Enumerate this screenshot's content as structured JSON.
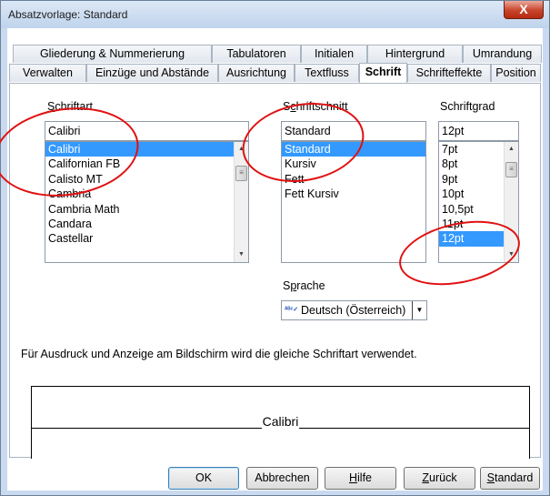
{
  "window": {
    "title": "Absatzvorlage: Standard",
    "close_glyph": "X"
  },
  "tabs_row1": [
    "Gliederung & Nummerierung",
    "Tabulatoren",
    "Initialen",
    "Hintergrund",
    "Umrandung"
  ],
  "tabs_row2": [
    "Verwalten",
    "Einzüge und Abstände",
    "Ausrichtung",
    "Textfluss",
    "Schrift",
    "Schrifteffekte",
    "Position"
  ],
  "active_tab": "Schrift",
  "font": {
    "label_accel": "S",
    "label_rest": "chriftart",
    "value": "Calibri",
    "items": [
      "Calibri",
      "Californian FB",
      "Calisto MT",
      "Cambria",
      "Cambria Math",
      "Candara",
      "Castellar"
    ],
    "selected": "Calibri"
  },
  "style": {
    "label_prefix": "S",
    "label_accel": "c",
    "label_rest": "hriftschnitt",
    "value": "Standard",
    "items": [
      "Standard",
      "Kursiv",
      "Fett",
      "Fett Kursiv"
    ],
    "selected": "Standard"
  },
  "size": {
    "label_prefix": "Schrift",
    "label_accel": "g",
    "label_rest": "rad",
    "value": "12pt",
    "items": [
      "7pt",
      "8pt",
      "9pt",
      "10pt",
      "10,5pt",
      "11pt",
      "12pt"
    ],
    "selected": "12pt"
  },
  "language": {
    "label_prefix": "S",
    "label_accel": "p",
    "label_rest": "rache",
    "value": "Deutsch (Österreich)",
    "icon": "abc-spellcheck-icon"
  },
  "info_text": "Für Ausdruck und Anzeige am Bildschirm wird die gleiche Schriftart verwendet.",
  "preview_text": "Calibri",
  "buttons": {
    "ok": "OK",
    "cancel": "Abbrechen",
    "help_accel": "H",
    "help_rest": "ilfe",
    "back_accel": "Z",
    "back_rest": "urück",
    "standard_accel": "S",
    "standard_rest": "tandard"
  },
  "colors": {
    "selection": "#3399ff",
    "annotation": "#e01010",
    "title_bar": "#c9d9ee"
  }
}
